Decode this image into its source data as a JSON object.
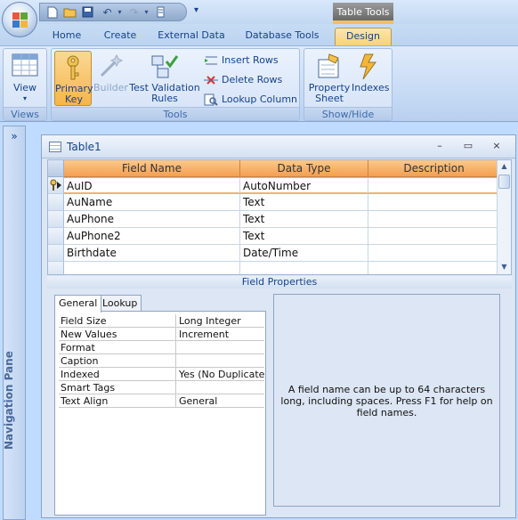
{
  "contextual_tab": "Table Tools",
  "tabs": [
    "Home",
    "Create",
    "External Data",
    "Database Tools",
    "Design"
  ],
  "ribbon": {
    "views": {
      "view_label": "View",
      "group_label": "Views"
    },
    "tools": {
      "primary_key_label": "Primary Key",
      "builder_label": "Builder",
      "test_validation_label": "Test Validation Rules",
      "insert_rows_label": "Insert Rows",
      "delete_rows_label": "Delete Rows",
      "lookup_column_label": "Lookup Column",
      "group_label": "Tools"
    },
    "show_hide": {
      "property_sheet_label": "Property Sheet",
      "indexes_label": "Indexes",
      "group_label": "Show/Hide"
    }
  },
  "nav_pane": {
    "toggle": "»",
    "label": "Navigation Pane"
  },
  "document": {
    "title": "Table1",
    "window_controls": {
      "minimize": "–",
      "restore": "▭",
      "close": "×"
    },
    "grid": {
      "headers": [
        "Field Name",
        "Data Type",
        "Description"
      ],
      "rows": [
        {
          "field": "AuID",
          "type": "AutoNumber",
          "desc": ""
        },
        {
          "field": "AuName",
          "type": "Text",
          "desc": ""
        },
        {
          "field": "AuPhone",
          "type": "Text",
          "desc": ""
        },
        {
          "field": "AuPhone2",
          "type": "Text",
          "desc": ""
        },
        {
          "field": "Birthdate",
          "type": "Date/Time",
          "desc": ""
        }
      ]
    },
    "field_properties": {
      "title": "Field Properties",
      "tabs": [
        "General",
        "Lookup"
      ],
      "properties": [
        {
          "label": "Field Size",
          "value": "Long Integer"
        },
        {
          "label": "New Values",
          "value": "Increment"
        },
        {
          "label": "Format",
          "value": ""
        },
        {
          "label": "Caption",
          "value": ""
        },
        {
          "label": "Indexed",
          "value": "Yes (No Duplicates)"
        },
        {
          "label": "Smart Tags",
          "value": ""
        },
        {
          "label": "Text Align",
          "value": "General"
        }
      ],
      "help_text": "A field name can be up to 64 characters long, including spaces.  Press F1 for help on field names."
    }
  }
}
